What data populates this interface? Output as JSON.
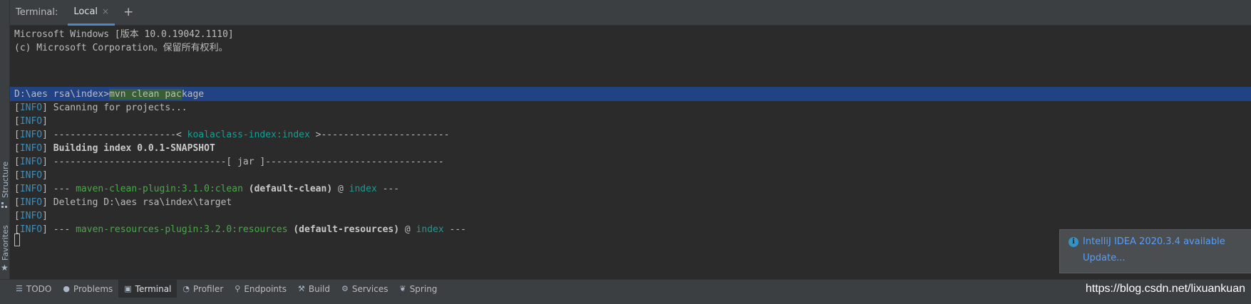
{
  "side_tabs": {
    "structure": "Structure",
    "favorites": "Favorites"
  },
  "terminal": {
    "title": "Terminal:",
    "tab_label": "Local",
    "close_glyph": "×",
    "add_glyph": "+"
  },
  "output": {
    "line1": "Microsoft Windows [版本 10.0.19042.1110]",
    "line2": "(c) Microsoft Corporation。保留所有权利。",
    "prompt": "D:\\aes rsa\\index>",
    "command_selected": "mvn clean pac",
    "command_rest": "kage",
    "info_tag": "INFO",
    "scan": " Scanning for projects...",
    "sep_left": " ----------------------< ",
    "artifact": "koalaclass-index:index",
    "sep_right": " >-----------------------",
    "building": "Building index 0.0.1-SNAPSHOT",
    "jar_line": " -------------------------------[ jar ]--------------------------------",
    "dashes": " --- ",
    "clean_plugin": "maven-clean-plugin:3.1.0:clean",
    "clean_exec": " (default-clean)",
    "at": " @ ",
    "module": "index",
    "tail": " ---",
    "deleting": " Deleting D:\\aes rsa\\index\\target",
    "res_plugin": "maven-resources-plugin:3.2.0:resources",
    "res_exec": " (default-resources)"
  },
  "notification": {
    "icon": "i",
    "title": "IntelliJ IDEA 2020.3.4 available",
    "link": "Update..."
  },
  "tool_windows": [
    {
      "icon": "☰",
      "label": "TODO"
    },
    {
      "icon": "●",
      "label": "Problems"
    },
    {
      "icon": "▣",
      "label": "Terminal"
    },
    {
      "icon": "◔",
      "label": "Profiler"
    },
    {
      "icon": "⚲",
      "label": "Endpoints"
    },
    {
      "icon": "⚒",
      "label": "Build"
    },
    {
      "icon": "⚙",
      "label": "Services"
    },
    {
      "icon": "❦",
      "label": "Spring"
    }
  ],
  "watermark": "https://blog.csdn.net/lixuankuan"
}
